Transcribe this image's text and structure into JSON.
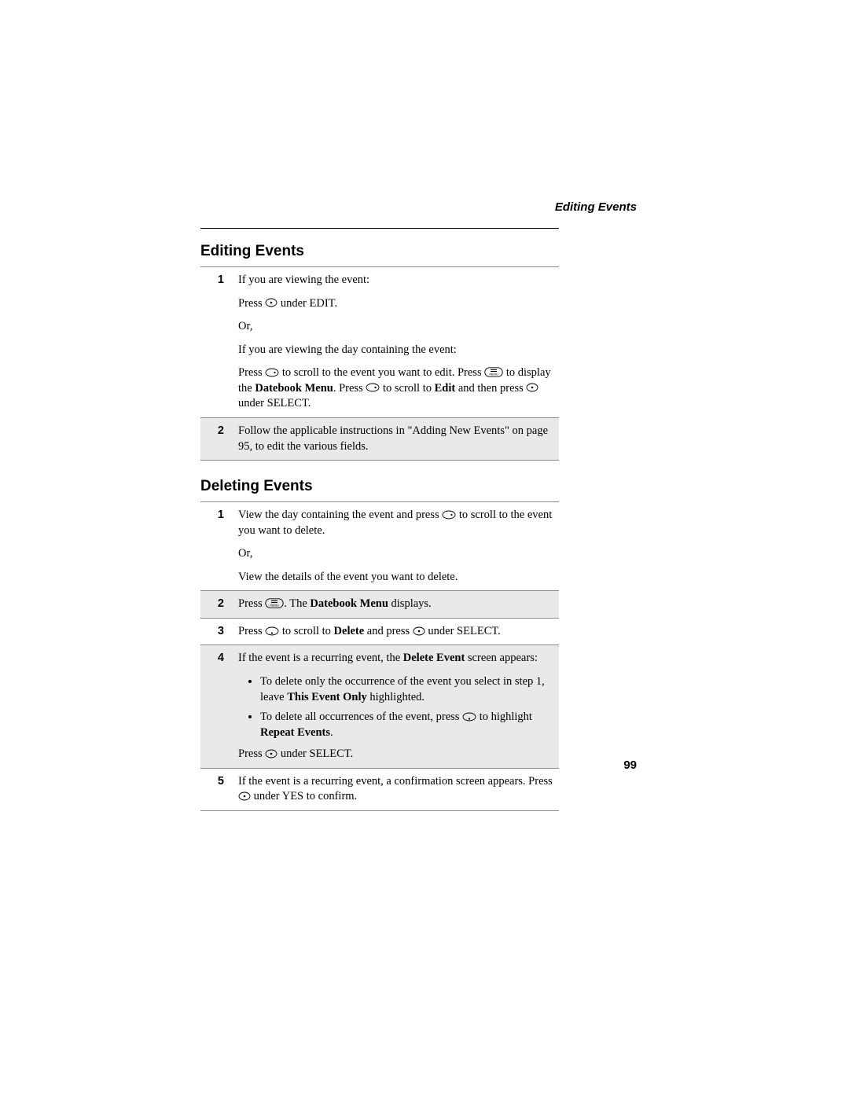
{
  "running_head": "Editing Events",
  "page_number": "99",
  "sections": {
    "editing": {
      "heading": "Editing Events",
      "step1": {
        "num": "1",
        "line1": "If you are viewing the event:",
        "press": "Press ",
        "underEdit": " under EDIT.",
        "or": "Or,",
        "line2": "If you are viewing the day containing the event:",
        "p3a": "Press ",
        "p3b": " to scroll to the event you want to edit. Press ",
        "p3c": " to display the ",
        "datebookMenu": "Datebook Menu",
        "p3d": ". Press ",
        "p3e": " to scroll to ",
        "editWord": "Edit",
        "p3f": " and then press ",
        "p3g": " under SELECT."
      },
      "step2": {
        "num": "2",
        "text": "Follow the applicable instructions in \"Adding New Events\" on page 95, to edit the various fields."
      }
    },
    "deleting": {
      "heading": "Deleting Events",
      "step1": {
        "num": "1",
        "a": "View the day containing the event and press ",
        "b": " to scroll to the event you want to delete.",
        "or": "Or,",
        "c": "View the details of the event you want to delete."
      },
      "step2": {
        "num": "2",
        "a": "Press ",
        "b": ". The ",
        "dbm": "Datebook Menu",
        "c": " displays."
      },
      "step3": {
        "num": "3",
        "a": "Press ",
        "b": " to scroll to ",
        "del": "Delete",
        "c": " and press ",
        "d": " under SELECT."
      },
      "step4": {
        "num": "4",
        "a": "If the event is a recurring event, the ",
        "de": "Delete Event",
        "b": " screen appears:",
        "li1a": "To delete only the occurrence of the event you select in step 1, leave ",
        "teo": "This Event Only",
        "li1b": " highlighted.",
        "li2a": "To delete all occurrences of the event, press ",
        "li2b": " to highlight ",
        "re": "Repeat Events",
        "li2c": ".",
        "pressA": "Press ",
        "pressB": " under SELECT."
      },
      "step5": {
        "num": "5",
        "a": "If the event is a recurring event, a confirmation screen appears. Press ",
        "b": " under YES to confirm."
      }
    }
  }
}
